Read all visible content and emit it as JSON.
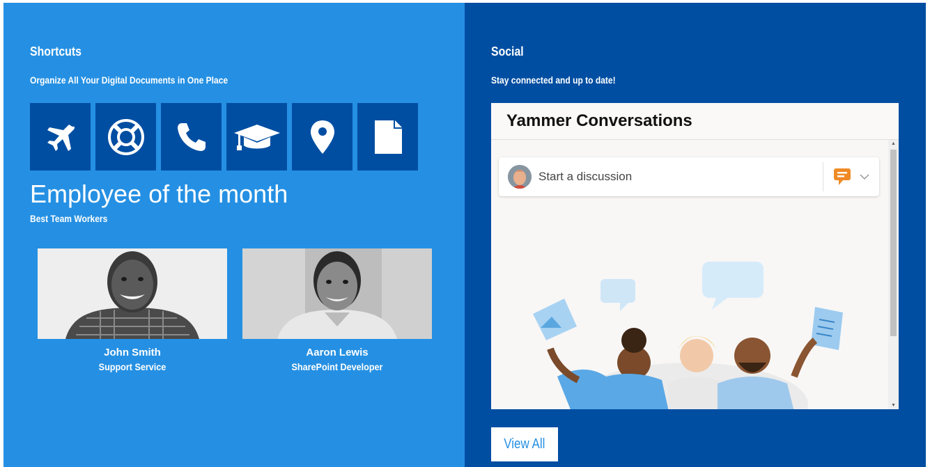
{
  "shortcuts": {
    "title": "Shortcuts",
    "subtitle": "Organize All Your Digital Documents in One Place",
    "tiles": [
      {
        "icon": "airplane-icon"
      },
      {
        "icon": "lifebuoy-icon"
      },
      {
        "icon": "phone-icon"
      },
      {
        "icon": "graduation-cap-icon"
      },
      {
        "icon": "map-pin-icon"
      },
      {
        "icon": "document-icon"
      }
    ]
  },
  "employee": {
    "title": "Employee of the month",
    "subtitle": "Best Team Workers",
    "people": [
      {
        "name": "John Smith",
        "role": "Support Service"
      },
      {
        "name": "Aaron Lewis",
        "role": "SharePoint Developer"
      }
    ]
  },
  "social": {
    "title": "Social",
    "subtitle": "Stay connected and up to date!",
    "widget_title": "Yammer Conversations",
    "composer_placeholder": "Start a discussion",
    "view_all": "View All"
  },
  "colors": {
    "left_bg": "#2590e3",
    "right_bg": "#004ea2",
    "tile_bg": "#004ea2",
    "chat_icon": "#f08a24"
  }
}
